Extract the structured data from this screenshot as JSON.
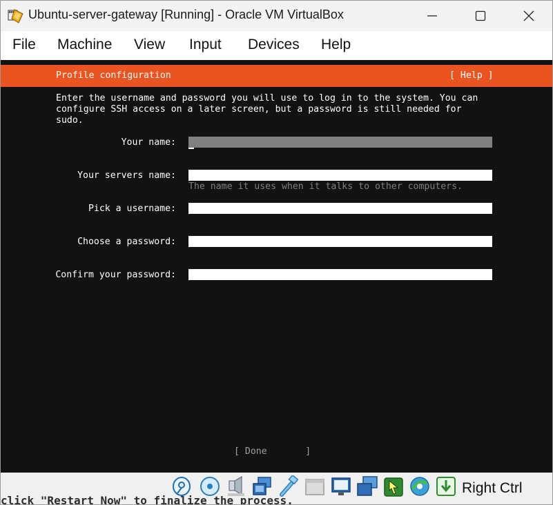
{
  "window": {
    "title": "Ubuntu-server-gateway [Running] - Oracle VM VirtualBox",
    "controls": [
      "minimize-icon",
      "maximize-icon",
      "close-icon"
    ]
  },
  "menu": {
    "items": [
      "File",
      "Machine",
      "View",
      "Input",
      "Devices",
      "Help"
    ]
  },
  "installer": {
    "header_title": "Profile configuration",
    "header_help": "[ Help ]",
    "intro_lines": [
      "Enter the username and password you will use to log in to the system. You can",
      "configure SSH access on a later screen, but a password is still needed for",
      "sudo."
    ],
    "fields": [
      {
        "label": "Your name:",
        "value": "",
        "active": true
      },
      {
        "label": "Your servers name:",
        "value": "",
        "hint": "The name it uses when it talks to other computers."
      },
      {
        "label": "Pick a username:",
        "value": ""
      },
      {
        "label": "Choose a password:",
        "value": ""
      },
      {
        "label": "Confirm your password:",
        "value": ""
      }
    ],
    "done_button": "[ Done       ]"
  },
  "statusbar": {
    "icons": [
      "hard-disk-icon",
      "optical-disk-icon",
      "audio-icon",
      "network-icon",
      "usb-icon",
      "shared-folder-icon",
      "display-icon",
      "capture-icon",
      "mouse-integration-icon",
      "guest-additions-icon",
      "keyboard-capture-icon"
    ],
    "host_key": "Right Ctrl"
  },
  "background_text": "click \"Restart Now\" to finalize the process.",
  "colors": {
    "ubuntu_orange": "#e95420",
    "terminal_bg": "#121212",
    "active_field": "#808080"
  }
}
